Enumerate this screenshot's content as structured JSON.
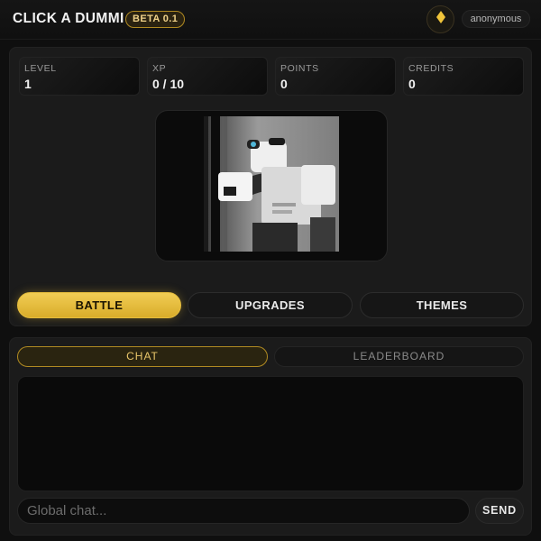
{
  "header": {
    "title": "CLICK A DUMMI",
    "badge": "BETA 0.1",
    "gem_icon": "diamond-icon",
    "username": "anonymous"
  },
  "stats": [
    {
      "label": "LEVEL",
      "value": "1"
    },
    {
      "label": "XP",
      "value": "0 / 10"
    },
    {
      "label": "POINTS",
      "value": "0"
    },
    {
      "label": "CREDITS",
      "value": "0"
    }
  ],
  "dummy": {
    "image_desc": "dummy-character-image"
  },
  "tabs": [
    {
      "label": "BATTLE",
      "active": true
    },
    {
      "label": "UPGRADES",
      "active": false
    },
    {
      "label": "THEMES",
      "active": false
    }
  ],
  "chat": {
    "tabs": [
      {
        "label": "CHAT",
        "active": true
      },
      {
        "label": "LEADERBOARD",
        "active": false
      }
    ],
    "placeholder": "Global chat...",
    "value": "",
    "send_label": "SEND"
  },
  "colors": {
    "accent": "#e6bd3d",
    "background": "#0f0f0f",
    "card": "#1b1b1b"
  }
}
